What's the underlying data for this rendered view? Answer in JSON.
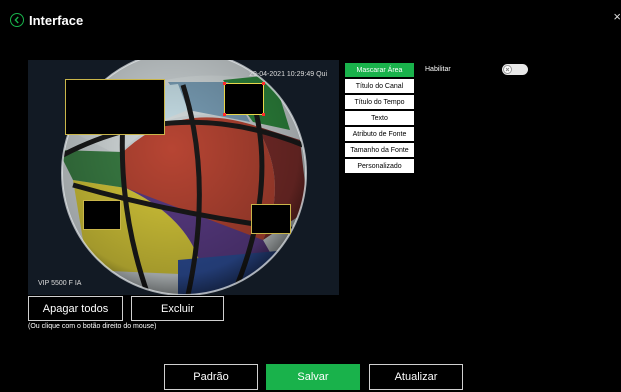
{
  "header": {
    "title": "Interface",
    "back_icon": "chevron-left-circle-icon",
    "close_icon": "close-icon"
  },
  "preview": {
    "timestamp": "29-04-2021 10:29:49 Qui",
    "camera_name": "VIP 5500 F IA"
  },
  "side_menu": {
    "items": [
      {
        "label": "Mascarar Área",
        "active": true
      },
      {
        "label": "Título do Canal",
        "active": false
      },
      {
        "label": "Título do Tempo",
        "active": false
      },
      {
        "label": "Texto",
        "active": false
      },
      {
        "label": "Atributo de Fonte",
        "active": false
      },
      {
        "label": "Tamanho da Fonte",
        "active": false
      },
      {
        "label": "Personalizado",
        "active": false
      }
    ]
  },
  "enable": {
    "label": "Habilitar",
    "on": false
  },
  "actions": {
    "clear_all": "Apagar todos",
    "delete": "Excluir",
    "hint": "(Ou clique com o botão direito do mouse)"
  },
  "footer": {
    "default": "Padrão",
    "save": "Salvar",
    "refresh": "Atualizar"
  },
  "colors": {
    "accent": "#19b24b",
    "mask_border": "#c9b54a",
    "handle": "#ff2a2a"
  }
}
